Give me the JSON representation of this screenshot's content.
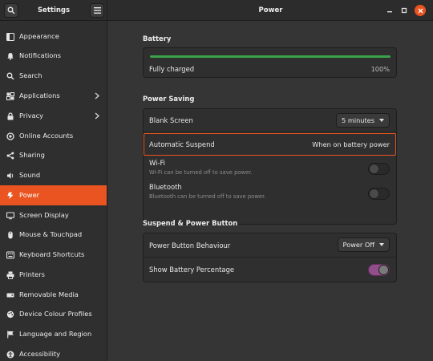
{
  "header": {
    "left_title": "Settings",
    "center_title": "Power",
    "search_icon": "search-icon",
    "menu_icon": "hamburger-menu-icon",
    "minimize_icon": "minimize-icon",
    "maximize_icon": "maximize-icon",
    "close_icon": "close-icon"
  },
  "sidebar": {
    "items": [
      {
        "label": "Appearance",
        "icon": "appearance-icon"
      },
      {
        "label": "Notifications",
        "icon": "bell-icon"
      },
      {
        "label": "Search",
        "icon": "search-icon"
      },
      {
        "label": "Applications",
        "icon": "grid-icon",
        "chevron": true
      },
      {
        "label": "Privacy",
        "icon": "lock-icon",
        "chevron": true
      },
      {
        "label": "Online Accounts",
        "icon": "online-accounts-icon"
      },
      {
        "label": "Sharing",
        "icon": "share-icon"
      },
      {
        "label": "Sound",
        "icon": "speaker-icon"
      },
      {
        "label": "Power",
        "icon": "power-icon",
        "active": true
      },
      {
        "label": "Screen Display",
        "icon": "display-icon"
      },
      {
        "label": "Mouse & Touchpad",
        "icon": "mouse-icon"
      },
      {
        "label": "Keyboard Shortcuts",
        "icon": "keyboard-icon"
      },
      {
        "label": "Printers",
        "icon": "printer-icon"
      },
      {
        "label": "Removable Media",
        "icon": "removable-media-icon"
      },
      {
        "label": "Device Colour Profiles",
        "icon": "colour-profiles-icon"
      },
      {
        "label": "Language and Region",
        "icon": "flag-icon"
      },
      {
        "label": "Accessibility",
        "icon": "accessibility-icon"
      }
    ]
  },
  "battery": {
    "title": "Battery",
    "status": "Fully charged",
    "percent_text": "100%",
    "level": 1.0,
    "bar_color": "#3aa34a"
  },
  "power_saving": {
    "title": "Power Saving",
    "blank_screen_label": "Blank Screen",
    "blank_screen_value": "5 minutes",
    "automatic_suspend_label": "Automatic Suspend",
    "automatic_suspend_value": "When on battery power",
    "wifi_label": "Wi-Fi",
    "wifi_sub": "Wi-Fi can be turned off to save power.",
    "wifi_on": false,
    "bluetooth_label": "Bluetooth",
    "bluetooth_sub": "Bluetooth can be turned off to save power.",
    "bluetooth_on": false
  },
  "suspend_power_button": {
    "title": "Suspend & Power Button",
    "power_button_label": "Power Button Behaviour",
    "power_button_value": "Power Off",
    "show_battery_label": "Show Battery Percentage",
    "show_battery_on": true
  },
  "colors": {
    "accent": "#e95420",
    "switch_on": "#924d8b"
  }
}
